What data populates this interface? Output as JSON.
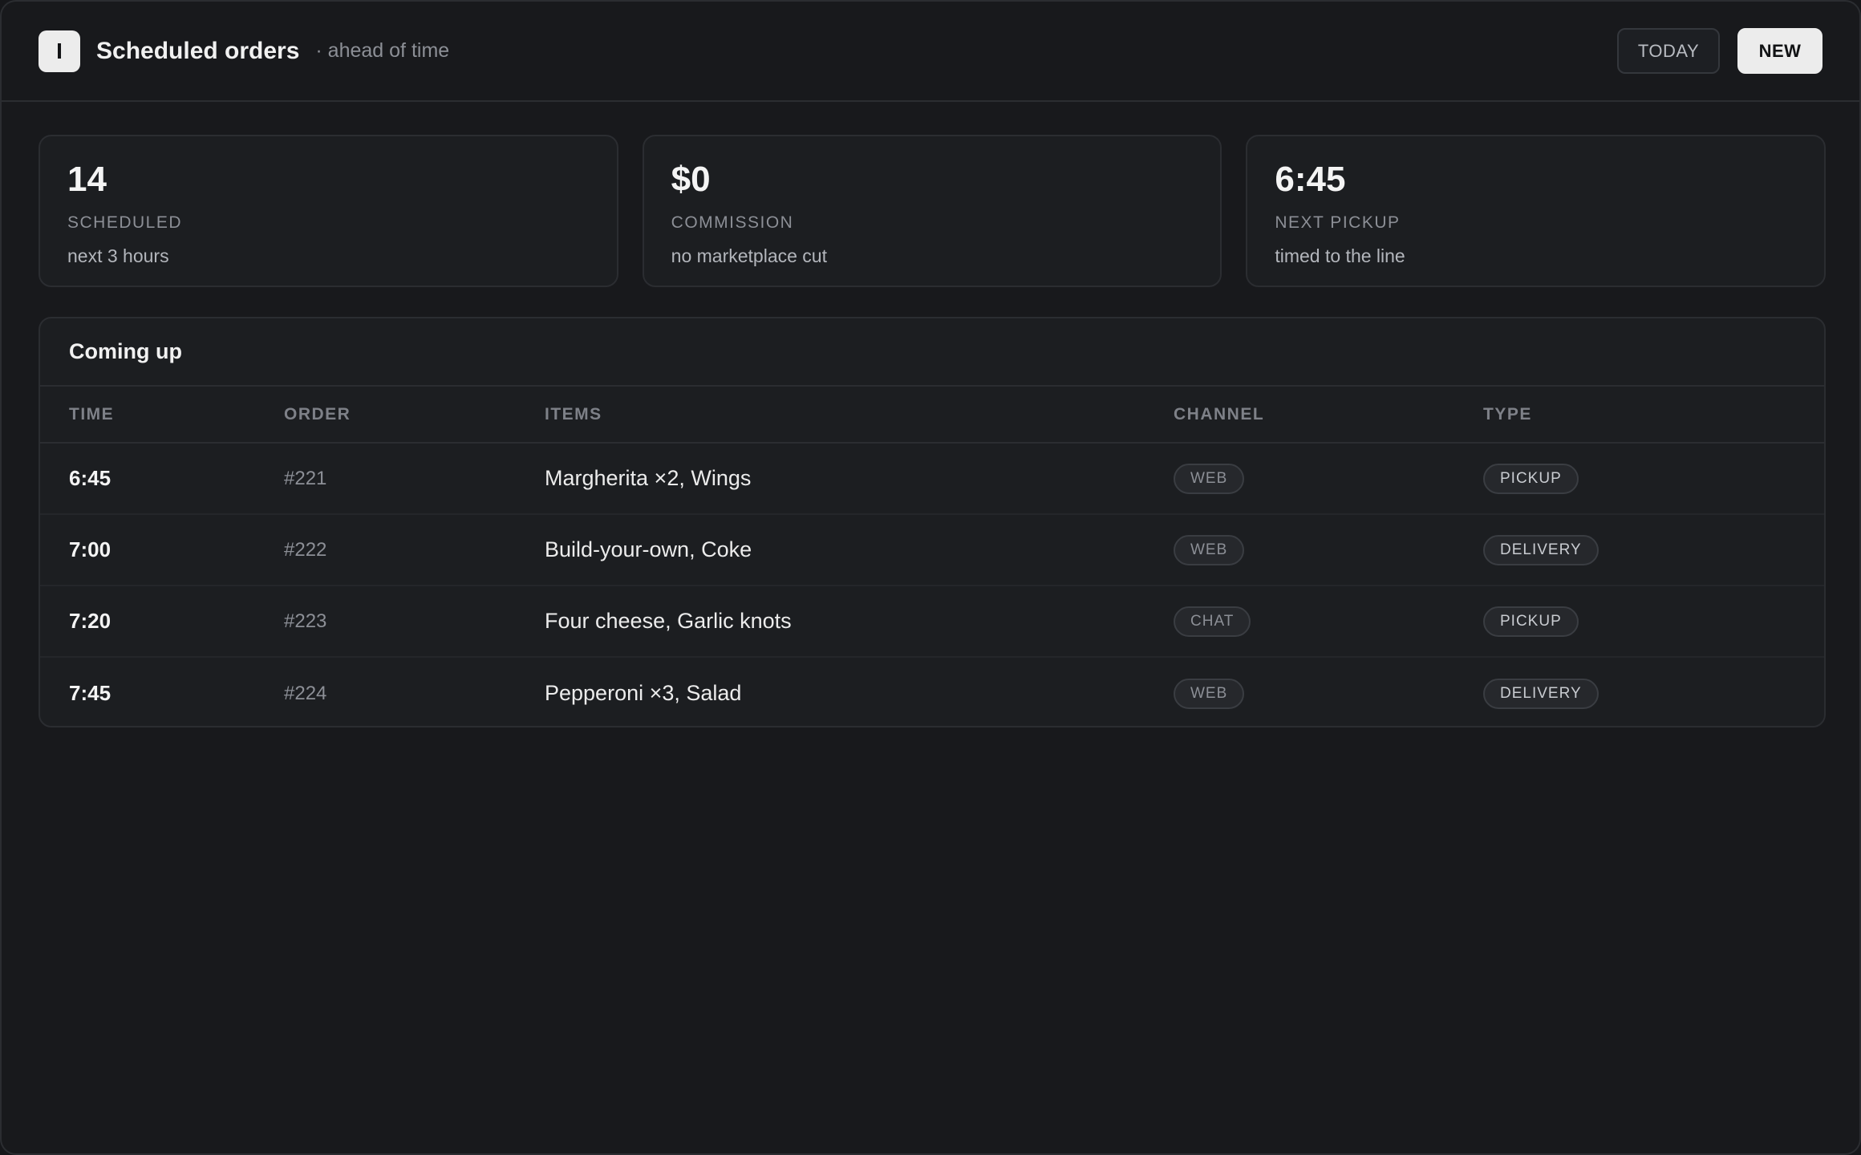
{
  "header": {
    "logo_letter": "I",
    "title": "Scheduled orders",
    "subtitle": "· ahead of time",
    "today_label": "TODAY",
    "new_label": "NEW"
  },
  "stats": [
    {
      "value": "14",
      "label": "SCHEDULED",
      "note": "next 3 hours"
    },
    {
      "value": "$0",
      "label": "COMMISSION",
      "note": "no marketplace cut"
    },
    {
      "value": "6:45",
      "label": "NEXT PICKUP",
      "note": "timed to the line"
    }
  ],
  "panel": {
    "title": "Coming up",
    "columns": [
      "TIME",
      "ORDER",
      "ITEMS",
      "CHANNEL",
      "TYPE"
    ],
    "rows": [
      {
        "time": "6:45",
        "order": "#221",
        "items": "Margherita ×2, Wings",
        "channel": "WEB",
        "type": "PICKUP"
      },
      {
        "time": "7:00",
        "order": "#222",
        "items": "Build-your-own, Coke",
        "channel": "WEB",
        "type": "DELIVERY"
      },
      {
        "time": "7:20",
        "order": "#223",
        "items": "Four cheese, Garlic knots",
        "channel": "CHAT",
        "type": "PICKUP"
      },
      {
        "time": "7:45",
        "order": "#224",
        "items": "Pepperoni ×3, Salad",
        "channel": "WEB",
        "type": "DELIVERY"
      }
    ]
  }
}
